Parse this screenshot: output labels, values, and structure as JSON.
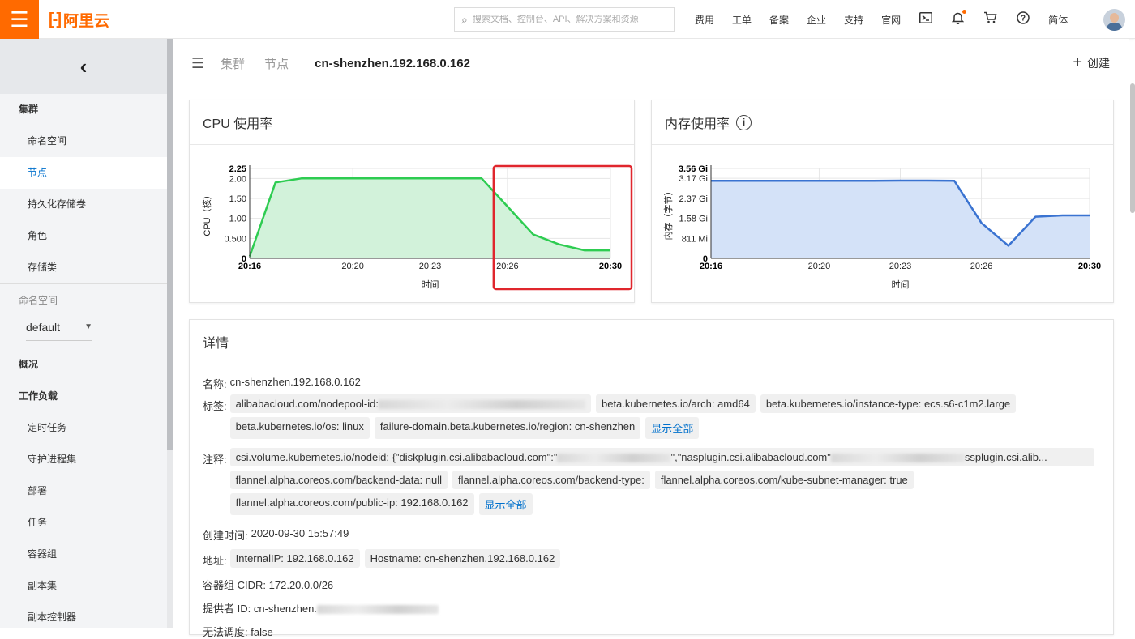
{
  "topbar": {
    "menu_icon": "hamburger-icon",
    "logo_mark": "[-]",
    "logo_text": "阿里云",
    "search_placeholder": "搜索文档、控制台、API、解决方案和资源",
    "nav": [
      "费用",
      "工单",
      "备案",
      "企业",
      "支持",
      "官网"
    ],
    "lang": "简体",
    "icons": [
      "terminal-icon",
      "bell-icon",
      "cart-icon",
      "help-icon"
    ],
    "accent": "#ff6a00"
  },
  "sidebar": {
    "back": "‹",
    "cluster_title": "集群",
    "cluster_items": [
      "命名空间",
      "节点",
      "持久化存储卷",
      "角色",
      "存储类"
    ],
    "active_item": "节点",
    "namespace_label": "命名空间",
    "namespace_value": "default",
    "overview": "概况",
    "workload_title": "工作负载",
    "workload_items": [
      "定时任务",
      "守护进程集",
      "部署",
      "任务",
      "容器组",
      "副本集",
      "副本控制器"
    ]
  },
  "breadcrumb": {
    "items": [
      "集群",
      "节点"
    ],
    "current": "cn-shenzhen.192.168.0.162"
  },
  "create_label": "创建",
  "cpu_chart": {
    "title": "CPU 使用率",
    "chart_data": {
      "type": "area",
      "title": "CPU 使用率",
      "xlabel": "时间",
      "ylabel": "CPU（核）",
      "x_ticks": [
        "20:16",
        "20:20",
        "20:23",
        "20:26",
        "20:30"
      ],
      "y_ticks": [
        "2.25",
        "2.00",
        "1.50",
        "1.00",
        "0.500",
        "0"
      ],
      "ylim": [
        0,
        2.25
      ],
      "x": [
        "20:16",
        "20:17",
        "20:18",
        "20:19",
        "20:20",
        "20:21",
        "20:22",
        "20:23",
        "20:24",
        "20:25",
        "20:26",
        "20:27",
        "20:28",
        "20:29",
        "20:30"
      ],
      "series": [
        {
          "values": [
            0.05,
            1.9,
            2.0,
            2.0,
            2.0,
            2.0,
            2.0,
            2.0,
            2.0,
            2.0,
            1.3,
            0.6,
            0.35,
            0.2,
            0.2
          ]
        }
      ],
      "color": "#2ecc51",
      "fill": "#d2f2da",
      "highlight_box_color": "#e0262d",
      "grid": true
    }
  },
  "mem_chart": {
    "title": "内存使用率",
    "chart_data": {
      "type": "area",
      "title": "内存使用率",
      "xlabel": "时间",
      "ylabel": "内存（字节）",
      "x_ticks": [
        "20:16",
        "20:20",
        "20:23",
        "20:26",
        "20:30"
      ],
      "y_ticks": [
        "3.56 Gi",
        "3.17 Gi",
        "2.37 Gi",
        "1.58 Gi",
        "811 Mi",
        "0"
      ],
      "ylim": [
        0,
        3.56
      ],
      "x": [
        "20:16",
        "20:17",
        "20:18",
        "20:19",
        "20:20",
        "20:21",
        "20:22",
        "20:23",
        "20:24",
        "20:25",
        "20:26",
        "20:27",
        "20:28",
        "20:29",
        "20:30"
      ],
      "series": [
        {
          "values": [
            3.07,
            3.07,
            3.07,
            3.07,
            3.07,
            3.07,
            3.07,
            3.08,
            3.08,
            3.07,
            1.4,
            0.5,
            1.65,
            1.7,
            1.7
          ]
        }
      ],
      "color": "#3a73d1",
      "fill": "#d4e2f8",
      "grid": true
    }
  },
  "details": {
    "title": "详情",
    "name_label": "名称:",
    "name_value": "cn-shenzhen.192.168.0.162",
    "labels_label": "标签:",
    "labels": [
      "alibabacloud.com/nodepool-id:",
      "beta.kubernetes.io/arch: amd64",
      "beta.kubernetes.io/instance-type: ecs.s6-c1m2.large",
      "beta.kubernetes.io/os: linux",
      "failure-domain.beta.kubernetes.io/region: cn-shenzhen"
    ],
    "labels_show_all": "显示全部",
    "annotations_label": "注释:",
    "annotations_first_a": "csi.volume.kubernetes.io/nodeid:  {\"diskplugin.csi.alibabacloud.com\":\"",
    "annotations_first_b": "\",\"nasplugin.csi.alibabacloud.com\"",
    "annotations_first_c": "ssplugin.csi.alib...",
    "annotations": [
      "flannel.alpha.coreos.com/backend-data:  null",
      "flannel.alpha.coreos.com/backend-type:",
      "flannel.alpha.coreos.com/kube-subnet-manager:  true",
      "flannel.alpha.coreos.com/public-ip:  192.168.0.162"
    ],
    "annotations_show_all": "显示全部",
    "created_label": "创建时间:",
    "created_value": "2020-09-30 15:57:49",
    "address_label": "地址:",
    "addresses": [
      "InternalIP: 192.168.0.162",
      "Hostname: cn-shenzhen.192.168.0.162"
    ],
    "cidr_label": "容器组 CIDR:",
    "cidr_value": "172.20.0.0/26",
    "provider_label": "提供者 ID:",
    "provider_value": "cn-shenzhen.",
    "unschedulable_label": "无法调度:",
    "unschedulable_value": "false"
  }
}
